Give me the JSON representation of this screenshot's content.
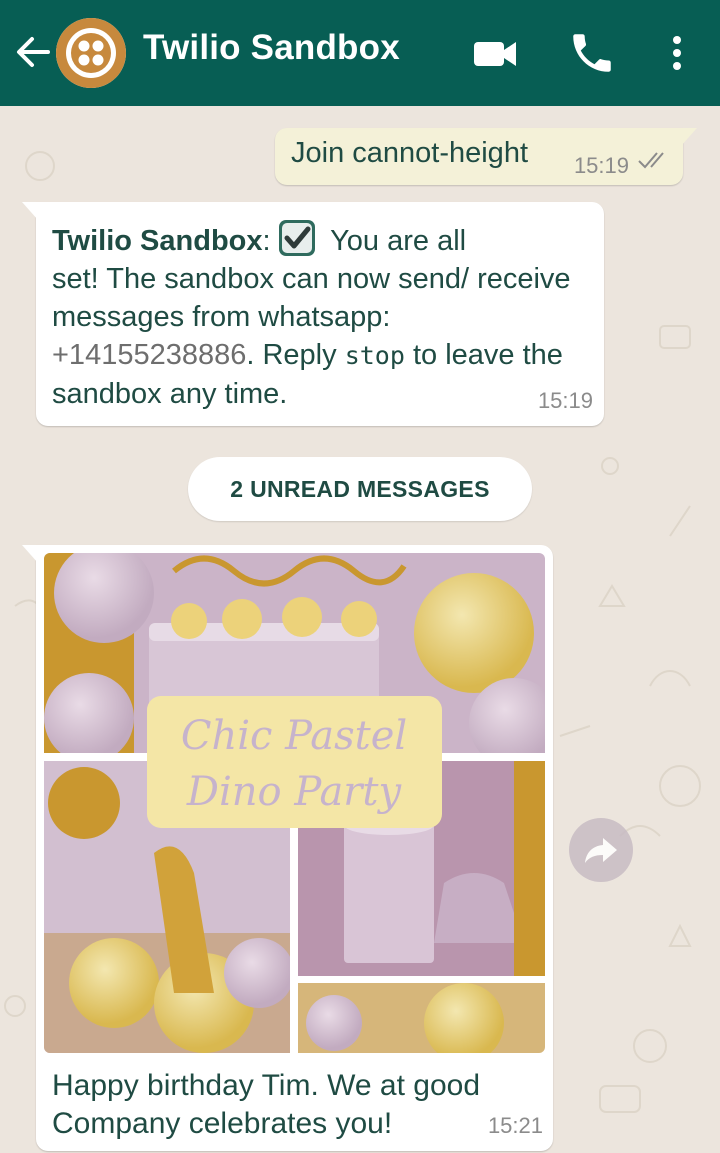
{
  "header": {
    "title": "Twilio Sandbox",
    "icons": [
      "back-arrow-icon",
      "twilio-logo",
      "video-call-icon",
      "phone-call-icon",
      "more-options-icon"
    ]
  },
  "messages": {
    "outgoing_1": {
      "text": "Join cannot-height",
      "time": "15:19",
      "status": "read"
    },
    "incoming_1": {
      "sender": "Twilio Sandbox",
      "colon": ":",
      "line1": " You are all",
      "line2": "set! The sandbox can now send/ receive messages from whatsapp: ",
      "phone": "+14155238886",
      "reply_prefix": ". Reply ",
      "stop_word": "stop",
      "reply_suffix": " to leave the sandbox any time.",
      "time": "15:19"
    },
    "unread_divider": "2 UNREAD MESSAGES",
    "incoming_2": {
      "image_title_line1": "Chic Pastel",
      "image_title_line2": "Dino Party",
      "caption": "Happy birthday Tim. We at good Company celebrates you!",
      "time": "15:21"
    }
  },
  "colors": {
    "header": "#075e54",
    "chat_background": "#ece5dd",
    "outgoing_bubble": "#f4f1d8",
    "incoming_bubble": "#ffffff",
    "text": "#1f4b43",
    "twilio_logo": "#c7893d"
  }
}
